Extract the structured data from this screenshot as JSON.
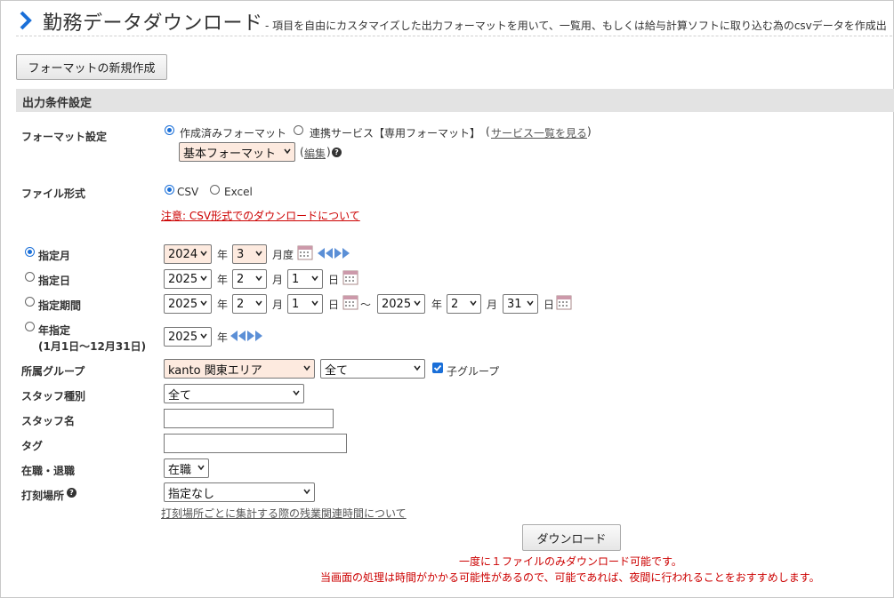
{
  "header": {
    "title": "勤務データダウンロード",
    "description": "- 項目を自由にカスタマイズした出力フォーマットを用いて、一覧用、もしくは給与計算ソフトに取り込む為のcsvデータを作成出"
  },
  "new_format_button": "フォーマットの新規作成",
  "section_title": "出力条件設定",
  "format": {
    "label": "フォーマット設定",
    "opt_created": "作成済みフォーマット",
    "opt_service": "連携サービス【専用フォーマット】",
    "service_link_open": "(",
    "service_link": "サービス一覧を見る",
    "service_link_close": ")",
    "selected": "基本フォーマット",
    "edit_open": "(",
    "edit_link": "編集",
    "edit_close": ")"
  },
  "file_type": {
    "label": "ファイル形式",
    "csv": "CSV",
    "excel": "Excel",
    "notice": "注意: CSV形式でのダウンロードについて"
  },
  "period": {
    "month_label": "指定月",
    "day_label": "指定日",
    "range_label": "指定期間",
    "year_label": "年指定",
    "year_sub": "(1月1日〜12月31日)",
    "unit_year": "年",
    "unit_month": "月",
    "unit_day": "日",
    "unit_month_degree": "月度",
    "tilde": "〜",
    "month_year": "2024",
    "month_month": "3",
    "day_year": "2025",
    "day_month": "2",
    "day_day": "1",
    "range_from_year": "2025",
    "range_from_month": "2",
    "range_from_day": "1",
    "range_to_year": "2025",
    "range_to_month": "2",
    "range_to_day": "31",
    "year_year": "2025"
  },
  "group": {
    "label": "所属グループ",
    "selected": "kanto 関東エリア",
    "sub_selected": "全て",
    "child_label": "子グループ",
    "child_checked": true
  },
  "staff_type": {
    "label": "スタッフ種別",
    "selected": "全て"
  },
  "staff_name": {
    "label": "スタッフ名",
    "value": ""
  },
  "tag": {
    "label": "タグ",
    "value": ""
  },
  "employment": {
    "label": "在職・退職",
    "selected": "在職"
  },
  "stamp_place": {
    "label": "打刻場所",
    "selected": "指定なし",
    "link": "打刻場所ごとに集計する際の残業関連時間について"
  },
  "download": {
    "button": "ダウンロード",
    "note1": "一度に１ファイルのみダウンロード可能です。",
    "note2": "当画面の処理は時間がかかる可能性があるので、可能であれば、夜間に行われることをおすすめします。"
  },
  "colors": {
    "accent": "#1a6fd8",
    "warn": "#cc0000",
    "highlight": "#fdeadf",
    "section_bg": "#e3e3e3"
  }
}
